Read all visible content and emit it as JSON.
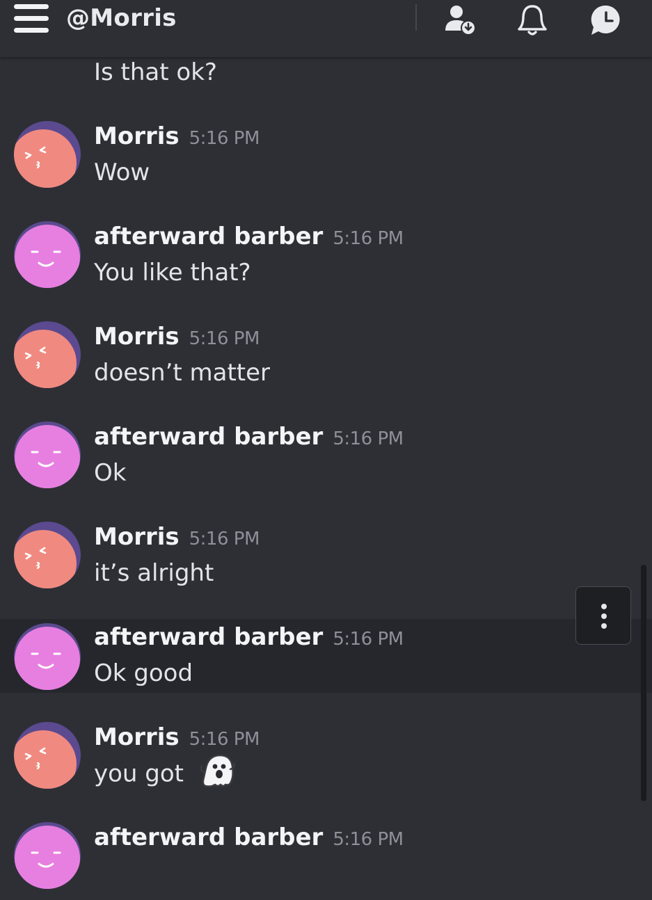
{
  "header": {
    "title": "@Morris",
    "icons": [
      "menu-icon",
      "user-download-icon",
      "bell-icon",
      "message-clock-icon"
    ]
  },
  "colors": {
    "background": "#2e2f35",
    "highlight_row": "#26272d",
    "morris_avatar": "#f08a80",
    "morris_avatar_hair": "#5b4a8f",
    "barber_avatar": "#e77fe0"
  },
  "messages": [
    {
      "author": "",
      "time": "",
      "text": "Is that ok?"
    },
    {
      "author": "Morris",
      "time": "5:16 PM",
      "text": "Wow"
    },
    {
      "author": "afterward barber",
      "time": "5:16 PM",
      "text": "You like that?"
    },
    {
      "author": "Morris",
      "time": "5:16 PM",
      "text": "doesn’t matter"
    },
    {
      "author": "afterward barber",
      "time": "5:16 PM",
      "text": "Ok"
    },
    {
      "author": "Morris",
      "time": "5:16 PM",
      "text": "it’s alright"
    },
    {
      "author": "afterward barber",
      "time": "5:16 PM",
      "text": "Ok good"
    },
    {
      "author": "Morris",
      "time": "5:16 PM",
      "text": "you got",
      "emoji": "ghost-emoji"
    },
    {
      "author": "afterward barber",
      "time": "5:16 PM",
      "text": ""
    }
  ]
}
